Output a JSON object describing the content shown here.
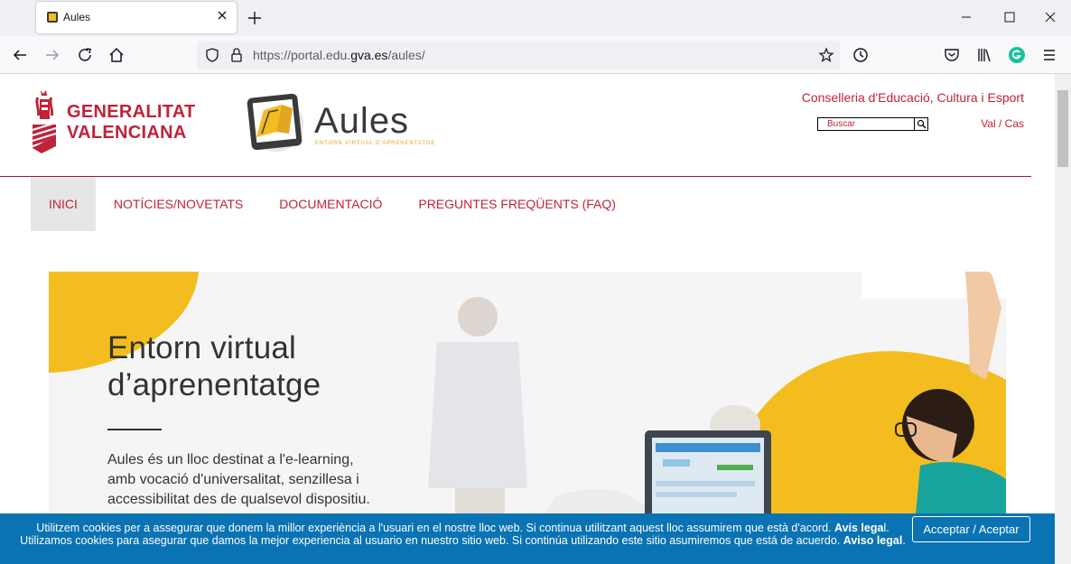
{
  "browser": {
    "tab_title": "Aules",
    "url_prefix": "https://portal.edu.",
    "url_domain": "gva.es",
    "url_path": "/aules/"
  },
  "header": {
    "gva_line1": "GENERALITAT",
    "gva_line2": "VALENCIANA",
    "aules_word": "Aules",
    "aules_sub": "ENTORN VIRTUAL D'APRENENTATGE",
    "conselleria": "Conselleria d'Educació, Cultura i Esport",
    "search_placeholder": "Buscar",
    "lang": "Val / Cas"
  },
  "menu": {
    "items": [
      {
        "label": "INICI",
        "active": true
      },
      {
        "label": "NOTÍCIES/NOVETATS",
        "active": false
      },
      {
        "label": "DOCUMENTACIÓ",
        "active": false
      },
      {
        "label": "PREGUNTES FREQÜENTS (FAQ)",
        "active": false
      }
    ]
  },
  "hero": {
    "title_line1": "Entorn virtual",
    "title_line2": "d’aprenentatge",
    "desc_line1": "Aules és un lloc destinat a l'e-learning,",
    "desc_line2": "amb vocació d'universalitat, senzillesa i",
    "desc_line3": "accessibilitat des de qualsevol dispositiu."
  },
  "cookie": {
    "line1": "Utilitzem cookies per a assegurar que donem la millor experiència a l'usuari en el nostre lloc web. Si continua utilitzant aquest lloc assumirem que està d'acord.",
    "link1a": "Avís lega",
    "link1b": "l",
    "line2": ". Utilizamos cookies para asegurar que damos la mejor experiencia al usuario en nuestro sitio web. Si continúa utilizando este sitio asumiremos que está de acuerdo.",
    "link2": "Aviso legal",
    "end": ".",
    "accept_label": "Acceptar / Aceptar"
  },
  "colors": {
    "brand_red": "#c0223a",
    "aules_yellow": "#f3bd1f",
    "cookie_blue": "#0a73b3"
  },
  "icons": [
    "favicon-icon",
    "close-icon",
    "plus-icon",
    "minimize-icon",
    "maximize-icon",
    "back-icon",
    "forward-icon",
    "reload-icon",
    "home-icon",
    "shield-icon",
    "lock-icon",
    "star-icon",
    "history-icon",
    "pocket-icon",
    "library-icon",
    "grammarly-icon",
    "menu-icon",
    "search-icon"
  ]
}
